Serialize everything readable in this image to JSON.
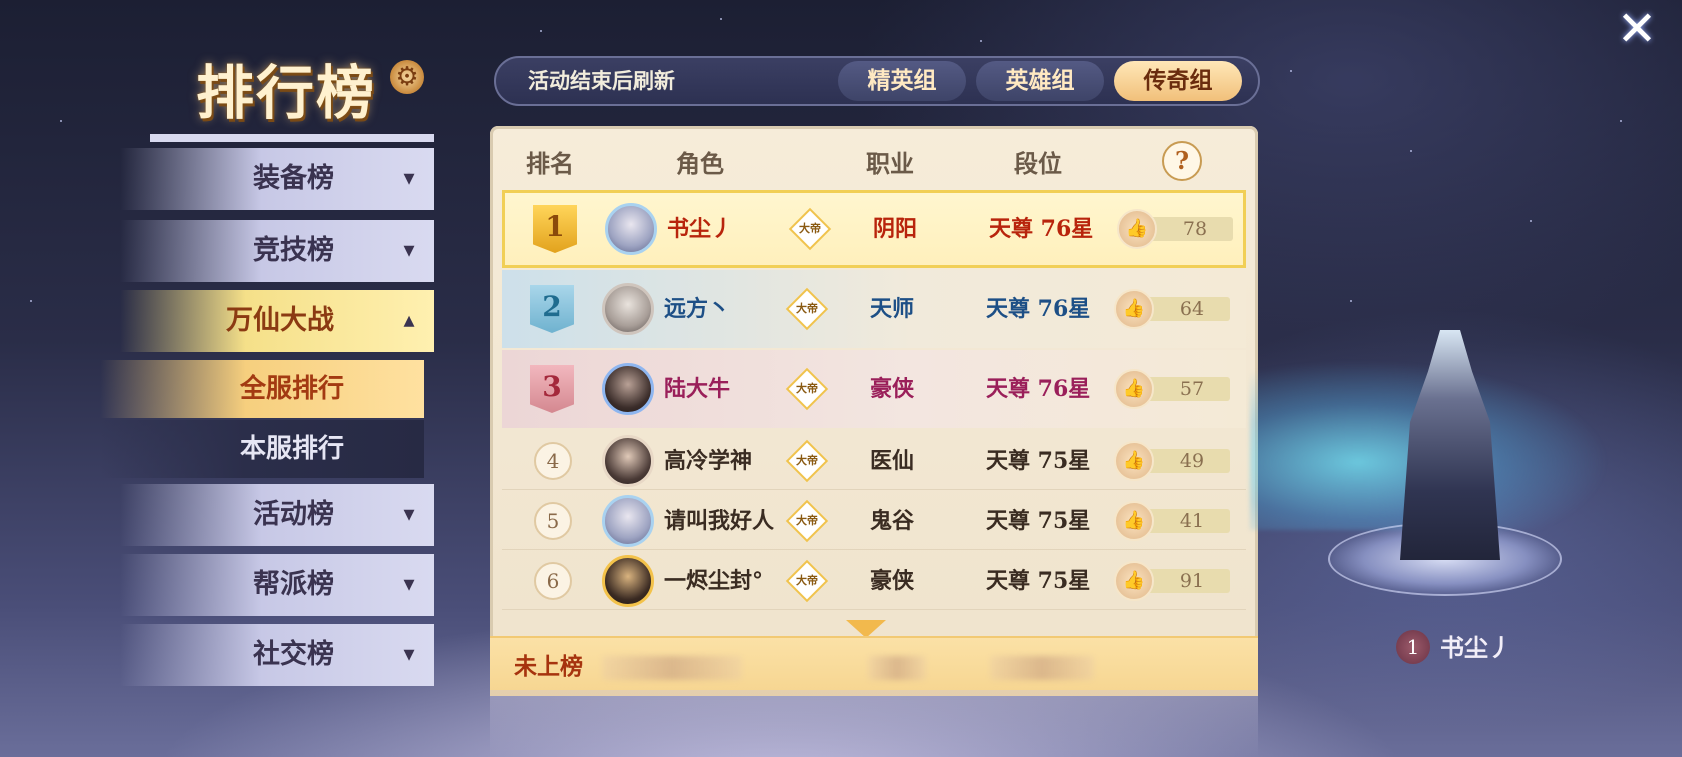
{
  "title": "排行榜",
  "sidebar": {
    "items": [
      {
        "label": "装备榜",
        "chevron": "▾"
      },
      {
        "label": "竞技榜",
        "chevron": "▾"
      },
      {
        "label": "万仙大战",
        "chevron": "▴"
      },
      {
        "label": "活动榜",
        "chevron": "▾"
      },
      {
        "label": "帮派榜",
        "chevron": "▾"
      },
      {
        "label": "社交榜",
        "chevron": "▾"
      }
    ],
    "subitems": [
      {
        "label": "全服排行"
      },
      {
        "label": "本服排行"
      }
    ]
  },
  "topbar": {
    "note": "活动结束后刷新",
    "tabs": [
      {
        "label": "精英组"
      },
      {
        "label": "英雄组"
      },
      {
        "label": "传奇组"
      }
    ]
  },
  "table": {
    "headers": {
      "rank": "排名",
      "role": "角色",
      "class": "职业",
      "tier": "段位",
      "help": "?"
    },
    "rows": [
      {
        "rank": "1",
        "name": "书尘丿",
        "emblem": "大帝",
        "class": "阴阳",
        "tier": "天尊 76星",
        "likes": "78"
      },
      {
        "rank": "2",
        "name": "远方丶",
        "emblem": "大帝",
        "class": "天师",
        "tier": "天尊 76星",
        "likes": "64"
      },
      {
        "rank": "3",
        "name": "陆大牛",
        "emblem": "大帝",
        "class": "豪侠",
        "tier": "天尊 76星",
        "likes": "57"
      },
      {
        "rank": "4",
        "name": "高冷学神",
        "emblem": "大帝",
        "class": "医仙",
        "tier": "天尊 75星",
        "likes": "49"
      },
      {
        "rank": "5",
        "name": "请叫我好人",
        "emblem": "大帝",
        "class": "鬼谷",
        "tier": "天尊 75星",
        "likes": "41"
      },
      {
        "rank": "6",
        "name": "一烬尘封°",
        "emblem": "大帝",
        "class": "豪侠",
        "tier": "天尊 75星",
        "likes": "91"
      }
    ],
    "self_row": {
      "label": "未上榜"
    }
  },
  "display": {
    "rank": "1",
    "name": "书尘丿"
  },
  "icons": {
    "close": "✕",
    "settings": "⚙",
    "like": "👍"
  },
  "colors": {
    "accent_gold": "#f1cf56",
    "rank1": "#b8240c",
    "rank2": "#1d4f86",
    "rank3": "#9a1f5a",
    "selected_tab": "#f1c07a"
  }
}
